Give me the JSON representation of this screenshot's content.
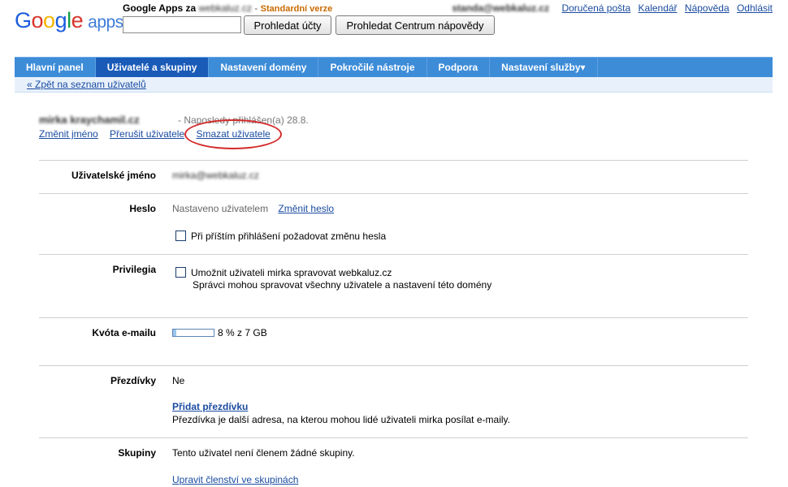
{
  "header": {
    "logo_text": "Google apps",
    "brand_prefix": "Google Apps za",
    "domain": "webkaluz.cz",
    "separator": "-",
    "version": "Standardní verze",
    "search_placeholder": "",
    "search_accounts_label": "Prohledat účty",
    "search_help_label": "Prohledat Centrum nápovědy",
    "user_email": "standa@webkaluz.cz",
    "links": [
      "Doručená pošta",
      "Kalendář",
      "Nápověda",
      "Odhlásit"
    ]
  },
  "nav": {
    "tabs": [
      "Hlavní panel",
      "Uživatelé a skupiny",
      "Nastavení domény",
      "Pokročilé nástroje",
      "Podpora",
      "Nastavení služby▾"
    ],
    "active_index": 1
  },
  "subnav": {
    "back_link": "« Zpět na seznam uživatelů"
  },
  "user": {
    "full_name": "mirka kraychamil.cz",
    "last_login": "- Naposledy přihlášen(a) 28.8.",
    "actions": [
      "Změnit jméno",
      "Přerušit uživatele",
      "Smazat uživatele"
    ]
  },
  "fields": {
    "username": {
      "label": "Uživatelské jméno",
      "value": "mirka@webkaluz.cz"
    },
    "password": {
      "label": "Heslo",
      "value": "Nastaveno uživatelem",
      "change_link": "Změnit heslo",
      "checkbox_label": "Při příštím přihlášení požadovat změnu hesla"
    },
    "privileges": {
      "label": "Privilegia",
      "checkbox_label": "Umožnit uživateli mirka spravovat webkaluz.cz",
      "note": "Správci mohou spravovat všechny uživatele a nastavení této domény"
    },
    "quota": {
      "label": "Kvóta e-mailu",
      "percent": 8,
      "text": "8 % z 7 GB"
    },
    "nicknames": {
      "label": "Přezdívky",
      "value": "Ne",
      "add_link": "Přidat přezdívku",
      "description": "Přezdívka je další adresa, na kterou mohou lidé uživateli mirka posílat e-maily."
    },
    "groups": {
      "label": "Skupiny",
      "value": "Tento uživatel není členem žádné skupiny.",
      "edit_link": "Upravit členství ve skupinách"
    }
  },
  "colors": {
    "nav": "#3d8cd8",
    "nav_active": "#1a5bb8",
    "link": "#1a4ba0",
    "highlight": "#d42a2a",
    "version": "#c96a00"
  }
}
